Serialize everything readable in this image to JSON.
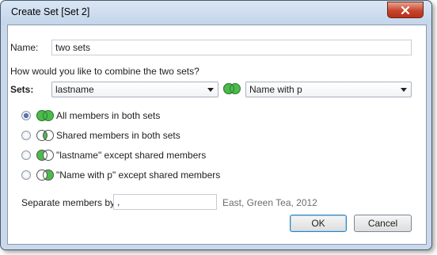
{
  "window": {
    "title": "Create Set [Set 2]"
  },
  "name_field": {
    "label": "Name:",
    "value": "two sets"
  },
  "combine_prompt": "How would you like to combine the two sets?",
  "sets": {
    "label": "Sets:",
    "left_set": "lastname",
    "right_set": "Name with p"
  },
  "options": [
    {
      "label": "All members in both sets",
      "selected": true,
      "icon": "venn-union-icon"
    },
    {
      "label": "Shared members in both sets",
      "selected": false,
      "icon": "venn-intersection-icon"
    },
    {
      "label": "\"lastname\" except shared members",
      "selected": false,
      "icon": "venn-left-except-icon"
    },
    {
      "label": "\"Name with p\" except shared members",
      "selected": false,
      "icon": "venn-right-except-icon"
    }
  ],
  "separator": {
    "label": "Separate members by",
    "value": ",",
    "example": "East, Green Tea, 2012"
  },
  "buttons": {
    "ok": "OK",
    "cancel": "Cancel"
  },
  "colors": {
    "venn_fill": "#4cbb4c",
    "venn_stroke": "#2e7d32",
    "titlebar": "#c9d8ea",
    "close_button": "#c7452c"
  }
}
